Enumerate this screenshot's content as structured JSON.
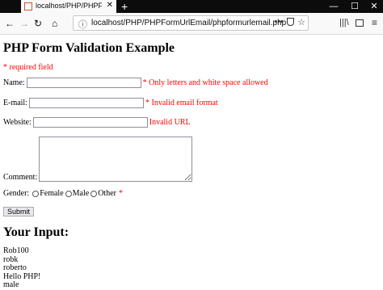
{
  "browser": {
    "tab_title": "localhost/PHP/PHPFormUrlEm",
    "url": "localhost/PHP/PHPFormUrlEmail/phpformurlemail.php",
    "new_tab": "+",
    "min": "—",
    "max": "☐",
    "close": "✕"
  },
  "form": {
    "heading": "PHP Form Validation Example",
    "required_note": "* required field",
    "name_label": "Name:",
    "name_error": "* Only letters and white space allowed",
    "email_label": "E-mail:",
    "email_error": "* Invalid email format",
    "website_label": "Website:",
    "website_error": "Invalid URL",
    "comment_label": "Comment:",
    "gender_label": "Gender:",
    "gender_options": [
      "Female",
      "Male",
      "Other"
    ],
    "gender_required": "*",
    "submit_label": "Submit"
  },
  "output": {
    "heading": "Your Input:",
    "lines": [
      "Rob100",
      "robk",
      "roberto",
      "Hello PHP!",
      "male"
    ]
  }
}
